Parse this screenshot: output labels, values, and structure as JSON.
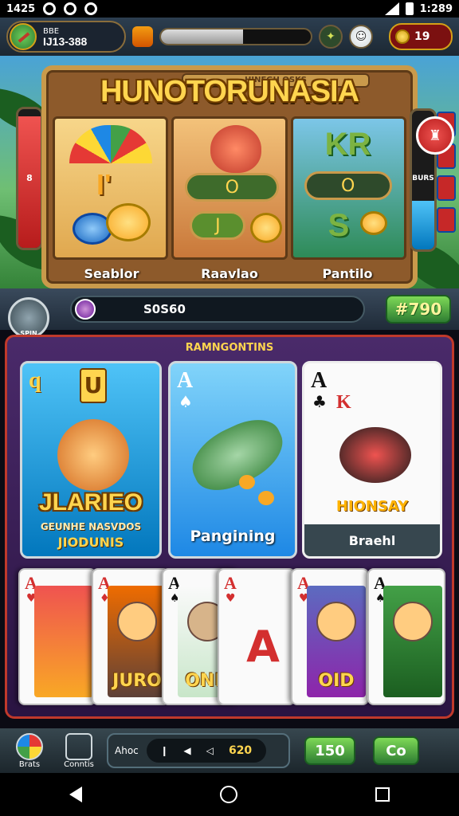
{
  "status_bar": {
    "time_left": "1425",
    "time_right": "1:289"
  },
  "hud": {
    "player_tag": "BBE",
    "player_id": "IJ13-388",
    "xp_progress": 0.55,
    "coins": "19"
  },
  "slot": {
    "plate_text": "HINEGH OSKS",
    "title": "HUNOTORUNASIA",
    "reel1_symbol": "I'",
    "reel2_symbol": "O",
    "reel2_row2": "J",
    "reel3_top": "KR",
    "reel3_symbol": "O",
    "reel3_bottom": "S",
    "reel_labels": [
      "Seablor",
      "Raavlao",
      "Pantilo"
    ],
    "left_meter_label": "8",
    "right_meter_label": "BURS",
    "left_meter_level": 0.95,
    "right_meter_level": 0.35
  },
  "spin": {
    "wheel_caption": "SPIN",
    "bet_value": "S0S60",
    "win_value": "#790"
  },
  "panel": {
    "title": "RAMNGONTINS",
    "card1": {
      "rank": "q",
      "badge": "U",
      "title": "JLARIEO",
      "sub1": "GEUNHE NASVDOS",
      "sub2": "JIODUNIS"
    },
    "card2": {
      "rank": "A",
      "suit": "♠",
      "caption": "Pangining"
    },
    "card3": {
      "rank": "A",
      "suit": "♣",
      "face_rank": "K",
      "banner": "HIONSAY",
      "caption": "Braehl"
    }
  },
  "hand": [
    {
      "rank": "A",
      "suit": "♥",
      "color": "red",
      "label": ""
    },
    {
      "rank": "A",
      "suit": "♦",
      "color": "red",
      "label": "JURO"
    },
    {
      "rank": "A",
      "suit": "♠",
      "color": "black",
      "label": "ONN"
    },
    {
      "rank": "A",
      "suit": "♥",
      "color": "red",
      "label": "A"
    },
    {
      "rank": "A",
      "suit": "♥",
      "color": "red",
      "label": "OID"
    },
    {
      "rank": "A",
      "suit": "♠",
      "color": "black",
      "label": ""
    }
  ],
  "bottom_bar": {
    "friends_label": "Brats",
    "contests_label": "Conntis",
    "media_label": "Ahoc",
    "media_value": "620",
    "btn1": "150",
    "btn2": "Co"
  },
  "colors": {
    "accent_gold": "#ffd54f",
    "panel_purple": "#4a2a6a",
    "win_green": "#2e7d32"
  }
}
